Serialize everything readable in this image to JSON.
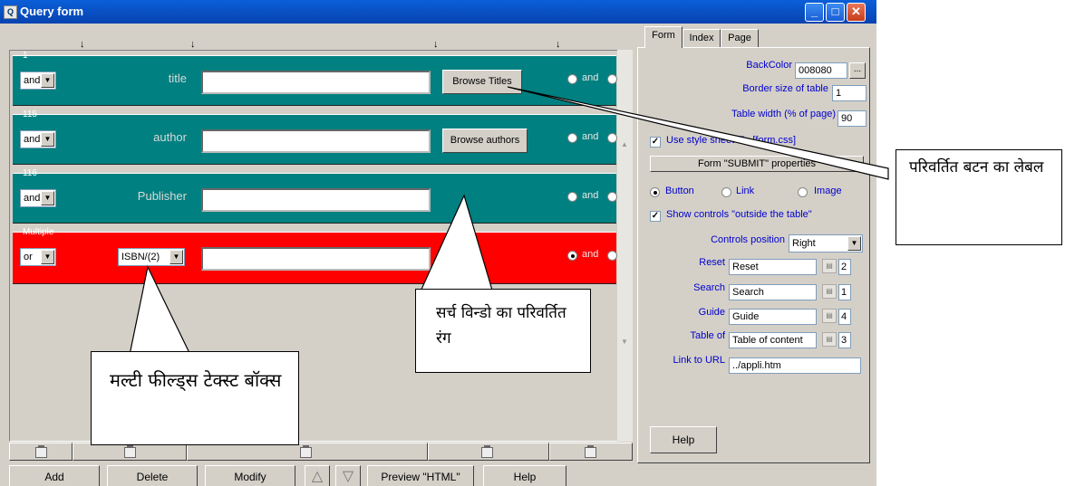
{
  "window": {
    "title": "Query form"
  },
  "columns_marker": "↓",
  "groups": [
    {
      "number": "1",
      "op": "and",
      "field": "title",
      "button": "Browse Titles",
      "radio_and": "and"
    },
    {
      "number": "115",
      "op": "and",
      "field": "author",
      "button": "Browse authors",
      "radio_and": "and"
    },
    {
      "number": "116",
      "op": "and",
      "field": "Publisher",
      "radio_and": "and"
    },
    {
      "number": "Multiple",
      "op": "or",
      "field_select": "ISBN/(2)",
      "radio_and": "and"
    }
  ],
  "bottom_buttons": {
    "add": "Add",
    "delete": "Delete",
    "modify": "Modify",
    "preview": "Preview \"HTML\"",
    "help": "Help"
  },
  "tabs": {
    "form": "Form",
    "index": "Index",
    "page": "Page"
  },
  "panel": {
    "backcolor_label": "BackColor",
    "backcolor_value": "008080",
    "ellipsis": "...",
    "border_label": "Border size of table",
    "border_value": "1",
    "width_label": "Table width (% of page)",
    "width_value": "90",
    "use_style_label": "Use style sheet file [form.css]",
    "submit_label": "Form \"SUBMIT\" properties",
    "radio_button": "Button",
    "radio_link": "Link",
    "radio_image": "Image",
    "show_controls_label": "Show controls \"outside the table\"",
    "controls_position_label": "Controls position",
    "controls_position_value": "Right",
    "reset_label": "Reset",
    "reset_value": "Reset",
    "reset_num": "2",
    "search_label": "Search",
    "search_value": "Search",
    "search_num": "1",
    "guide_label": "Guide",
    "guide_value": "Guide",
    "guide_num": "4",
    "table_label": "Table of",
    "table_value": "Table of content",
    "table_num": "3",
    "link_label": "Link to URL",
    "link_value": "../appli.htm",
    "help": "Help"
  },
  "callouts": {
    "button_label": "परिवर्तित बटन का लेबल",
    "search_color": "सर्च विन्डो का परिवर्तित रंग",
    "multi_field": "मल्टी फील्ड्स टेक्स्ट बॉक्स"
  },
  "colors": {
    "titlebar": "#0842b0",
    "teal": "#008080",
    "red": "#ff0000",
    "chrome": "#d4d0c8"
  }
}
